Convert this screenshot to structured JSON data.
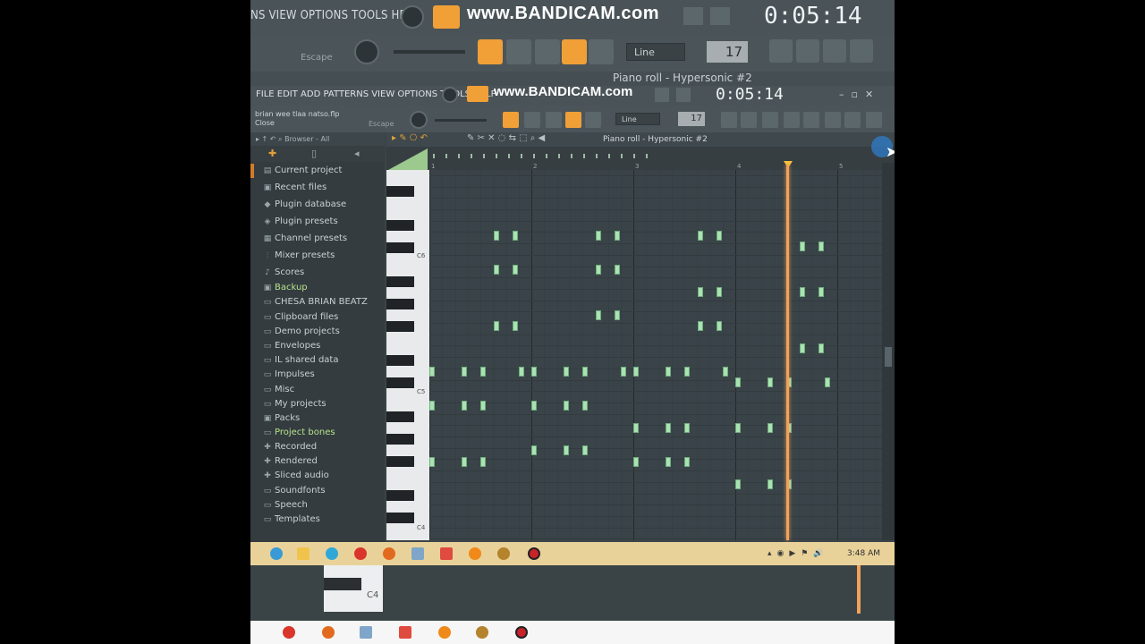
{
  "background_window": {
    "menu": "NS VIEW OPTIONS TOOLS HELP",
    "watermark": "www.BANDICAM.com",
    "time": "0:05:14",
    "hint_escape": "Escape",
    "snap": "Line",
    "tempo": "17",
    "piano_roll_title": "Piano roll - Hypersonic #2"
  },
  "window": {
    "menu": "FILE EDIT ADD PATTERNS VIEW OPTIONS TOOLS HELP",
    "watermark": "www.BANDICAM.com",
    "time": "0:05:14",
    "controls": "–▫✕",
    "hint_line1": "brian wee tlaa natso.flp",
    "hint_line2": "Close",
    "escape": "Escape",
    "snap": "Line",
    "tempo": "17"
  },
  "browser": {
    "header": "Browser - All",
    "items": [
      {
        "label": "Current project",
        "icon": "folder-project",
        "color": "normal"
      },
      {
        "label": "Recent files",
        "icon": "folder-green",
        "color": "normal"
      },
      {
        "label": "Plugin database",
        "icon": "plug",
        "color": "normal"
      },
      {
        "label": "Plugin presets",
        "icon": "plug-preset",
        "color": "normal"
      },
      {
        "label": "Channel presets",
        "icon": "channel",
        "color": "normal"
      },
      {
        "label": "Mixer presets",
        "icon": "mixer",
        "color": "normal"
      },
      {
        "label": "Scores",
        "icon": "note",
        "color": "normal"
      },
      {
        "label": "Backup",
        "icon": "folder-green",
        "color": "green"
      },
      {
        "label": "CHESA BRIAN BEATZ",
        "icon": "folder",
        "color": "normal"
      },
      {
        "label": "Clipboard files",
        "icon": "folder",
        "color": "normal"
      },
      {
        "label": "Demo projects",
        "icon": "folder",
        "color": "normal"
      },
      {
        "label": "Envelopes",
        "icon": "folder",
        "color": "normal"
      },
      {
        "label": "IL shared data",
        "icon": "folder",
        "color": "normal"
      },
      {
        "label": "Impulses",
        "icon": "folder",
        "color": "normal"
      },
      {
        "label": "Misc",
        "icon": "folder",
        "color": "normal"
      },
      {
        "label": "My projects",
        "icon": "folder",
        "color": "normal"
      },
      {
        "label": "Packs",
        "icon": "folder-blue",
        "color": "normal"
      },
      {
        "label": "Project bones",
        "icon": "folder",
        "color": "green"
      },
      {
        "label": "Recorded",
        "icon": "plus",
        "color": "normal"
      },
      {
        "label": "Rendered",
        "icon": "plus",
        "color": "normal"
      },
      {
        "label": "Sliced audio",
        "icon": "plus",
        "color": "normal"
      },
      {
        "label": "Soundfonts",
        "icon": "folder",
        "color": "normal"
      },
      {
        "label": "Speech",
        "icon": "folder",
        "color": "normal"
      },
      {
        "label": "Templates",
        "icon": "folder",
        "color": "normal"
      }
    ]
  },
  "piano_roll": {
    "title": "Piano roll - Hypersonic #2",
    "bar_numbers": [
      "1",
      "2",
      "3",
      "4",
      "5"
    ],
    "key_labels": [
      "C6",
      "C5",
      "C4"
    ],
    "playhead_bar": 4.5
  },
  "taskbar": {
    "clock": "3:48 AM"
  },
  "lower_preview": {
    "key_label": "C4"
  },
  "colors": {
    "accent_orange": "#f0a037",
    "note_green": "#a9e3b2",
    "playhead": "#f2a25a"
  }
}
